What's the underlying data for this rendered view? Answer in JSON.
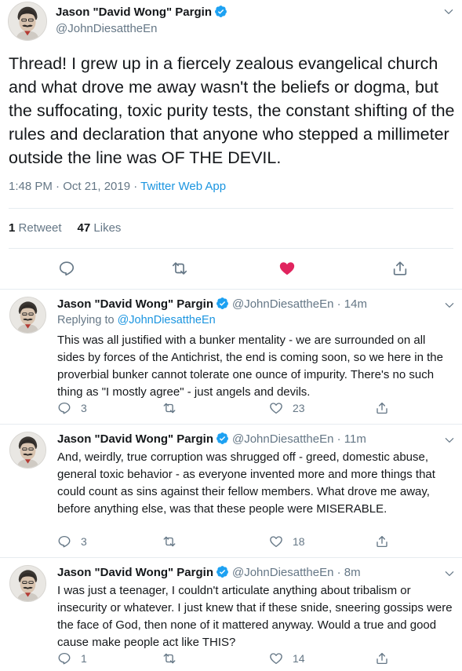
{
  "main_tweet": {
    "author_name": "Jason \"David Wong\" Pargin",
    "author_handle": "@JohnDiesattheEn",
    "text": "Thread! I grew up in a fiercely zealous evangelical church and what drove me away wasn't the beliefs or dogma, but the suffocating, toxic purity tests, the constant shifting of the rules and declaration that anyone who stepped a millimeter outside the line was OF THE DEVIL.",
    "time": "1:48 PM · Oct 21, 2019 · ",
    "source_app": "Twitter Web App",
    "retweets_count": "1",
    "retweets_label": "Retweet",
    "likes_count": "47",
    "likes_label": "Likes"
  },
  "replies": [
    {
      "author_name": "Jason \"David Wong\" Pargin",
      "author_handle": "@JohnDiesattheEn · 14m",
      "replying_prefix": "Replying to ",
      "replying_handle": "@JohnDiesattheEn",
      "text": "This was all justified with a bunker mentality - we are surrounded on all sides by forces of the Antichrist, the end is coming soon, so we here in the proverbial bunker cannot tolerate one ounce of impurity. There's no such thing as \"I mostly agree\" - just angels and devils.",
      "reply_count": "3",
      "like_count": "23"
    },
    {
      "author_name": "Jason \"David Wong\" Pargin",
      "author_handle": "@JohnDiesattheEn · 11m",
      "text": "And, weirdly, true corruption was shrugged off - greed, domestic abuse, general toxic behavior - as everyone invented more and more things that could count as sins against their fellow members. What drove me away, before anything else, was that these people were MISERABLE.",
      "reply_count": "3",
      "like_count": "18"
    },
    {
      "author_name": "Jason \"David Wong\" Pargin",
      "author_handle": "@JohnDiesattheEn · 8m",
      "text": "I was just a teenager, I couldn't articulate anything about tribalism or insecurity or whatever. I just knew that if these snide, sneering gossips were the face of God, then none of it mattered anyway. Would a true and good cause make people act like THIS?",
      "reply_count": "1",
      "like_count": "14"
    }
  ],
  "icons": {
    "reply": "reply-icon",
    "retweet": "retweet-icon",
    "like": "heart-icon",
    "share": "share-icon",
    "verified": "verified-badge-icon",
    "menu": "chevron-down-icon"
  },
  "colors": {
    "text_primary": "#14171a",
    "text_secondary": "#657786",
    "link": "#1b95e0",
    "like_active": "#e0245e",
    "verified": "#1da1f2",
    "divider": "#e6ecf0"
  }
}
